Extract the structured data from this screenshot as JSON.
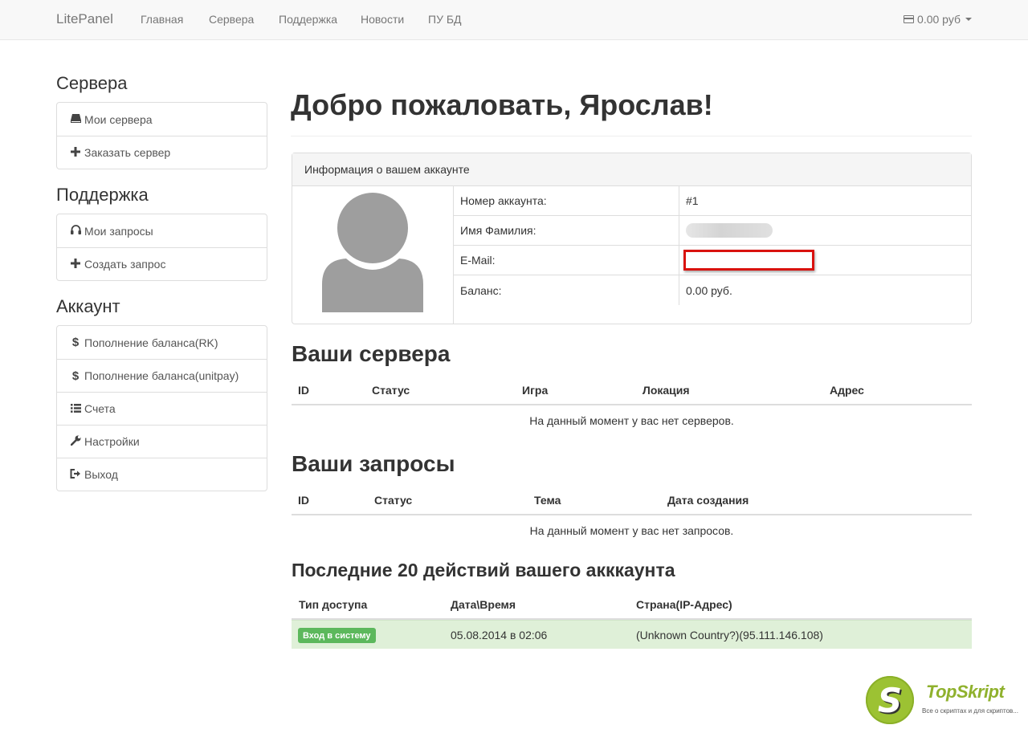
{
  "navbar": {
    "brand": "LitePanel",
    "items": [
      "Главная",
      "Сервера",
      "Поддержка",
      "Новости",
      "ПУ БД"
    ],
    "balance": "0.00 руб"
  },
  "sidebar": {
    "servers": {
      "heading": "Сервера",
      "items": [
        {
          "icon": "server-icon",
          "label": "Мои сервера"
        },
        {
          "icon": "plus-icon",
          "label": "Заказать сервер"
        }
      ]
    },
    "support": {
      "heading": "Поддержка",
      "items": [
        {
          "icon": "headphones-icon",
          "label": "Мои запросы"
        },
        {
          "icon": "plus-icon",
          "label": "Создать запрос"
        }
      ]
    },
    "account": {
      "heading": "Аккаунт",
      "items": [
        {
          "icon": "dollar-icon",
          "label": "Пополнение баланса(RK)"
        },
        {
          "icon": "dollar-icon",
          "label": "Пополнение баланса(unitpay)"
        },
        {
          "icon": "list-icon",
          "label": "Счета"
        },
        {
          "icon": "wrench-icon",
          "label": "Настройки"
        },
        {
          "icon": "logout-icon",
          "label": "Выход"
        }
      ]
    }
  },
  "main": {
    "title": "Добро пожаловать, Ярослав!",
    "account_panel": {
      "heading": "Информация о вашем аккаунте",
      "rows": [
        {
          "label": "Номер аккаунта:",
          "value": "#1"
        },
        {
          "label": "Имя Фамилия:",
          "value": ""
        },
        {
          "label": "E-Mail:",
          "value": ""
        },
        {
          "label": "Баланс:",
          "value": "0.00 руб."
        }
      ]
    },
    "servers": {
      "heading": "Ваши сервера",
      "columns": [
        "ID",
        "Статус",
        "Игра",
        "Локация",
        "Адрес"
      ],
      "empty": "На данный момент у вас нет серверов."
    },
    "requests": {
      "heading": "Ваши запросы",
      "columns": [
        "ID",
        "Статус",
        "Тема",
        "Дата создания"
      ],
      "empty": "На данный момент у вас нет запросов."
    },
    "activity": {
      "heading": "Последние 20 действий вашего акккаунта",
      "columns": [
        "Тип доступа",
        "Дата\\Время",
        "Страна(IP-Адрес)"
      ],
      "rows": [
        {
          "type": "Вход в систему",
          "datetime": "05.08.2014 в 02:06",
          "ip": "(Unknown Country?)(95.111.146.108)"
        }
      ]
    }
  },
  "watermark": {
    "letter": "S",
    "name": "TopSkript",
    "tagline": "Все о скриптах и для скриптов..."
  },
  "colors": {
    "navbar_bg": "#f8f8f8",
    "success_row": "#dff0d8",
    "badge": "#5cb85c",
    "highlight_border": "#d9120f",
    "watermark": "#9cc233"
  }
}
